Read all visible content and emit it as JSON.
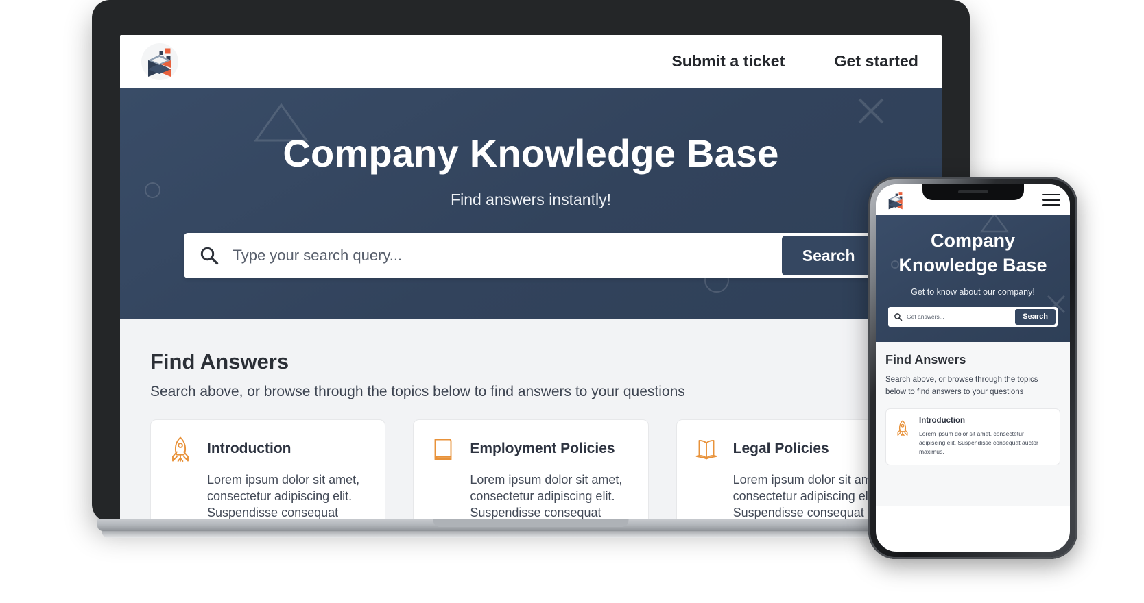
{
  "brand": {
    "logo_icon": "stacked-boxes-logo",
    "accent_navy": "#354761",
    "accent_orange": "#e8833a",
    "page_bg": "#ffffff"
  },
  "desktop": {
    "nav": {
      "logo_icon": "stacked-boxes-logo",
      "links": [
        {
          "label": "Submit a ticket",
          "name": "nav-link-submit-a-ticket"
        },
        {
          "label": "Get started",
          "name": "nav-link-get-started"
        }
      ]
    },
    "hero": {
      "title": "Company Knowledge Base",
      "subtitle": "Find answers instantly!",
      "search": {
        "icon": "search-icon",
        "placeholder": "Type your search query...",
        "value": "",
        "button_label": "Search"
      }
    },
    "find_answers": {
      "title": "Find Answers",
      "subtitle": "Search above, or browse through the topics below to find answers to your questions",
      "cards": [
        {
          "icon": "rocket-icon",
          "title": "Introduction",
          "body": "Lorem ipsum dolor sit amet, consectetur adipiscing elit. Suspendisse consequat auctor maximus."
        },
        {
          "icon": "closed-book-icon",
          "title": "Employment Policies",
          "body": "Lorem ipsum dolor sit amet, consectetur adipiscing elit. Suspendisse consequat auctor maximus."
        },
        {
          "icon": "open-book-icon",
          "title": "Legal Policies",
          "body": "Lorem ipsum dolor sit amet, consectetur adipiscing elit. Suspendisse consequat auctor maximus."
        }
      ]
    }
  },
  "mobile": {
    "nav": {
      "logo_icon": "stacked-boxes-logo",
      "menu_icon": "hamburger-menu-icon"
    },
    "hero": {
      "title": "Company Knowledge Base",
      "subtitle": "Get to know about our company!",
      "search": {
        "icon": "search-icon",
        "placeholder": "Get answers...",
        "value": "",
        "button_label": "Search"
      }
    },
    "find_answers": {
      "title": "Find Answers",
      "subtitle": "Search above, or browse through the topics below to find answers to your questions",
      "cards": [
        {
          "icon": "rocket-icon",
          "title": "Introduction",
          "body": "Lorem ipsum dolor sit amet, consectetur adipiscing elit. Suspendisse consequat auctor maximus."
        }
      ]
    }
  }
}
